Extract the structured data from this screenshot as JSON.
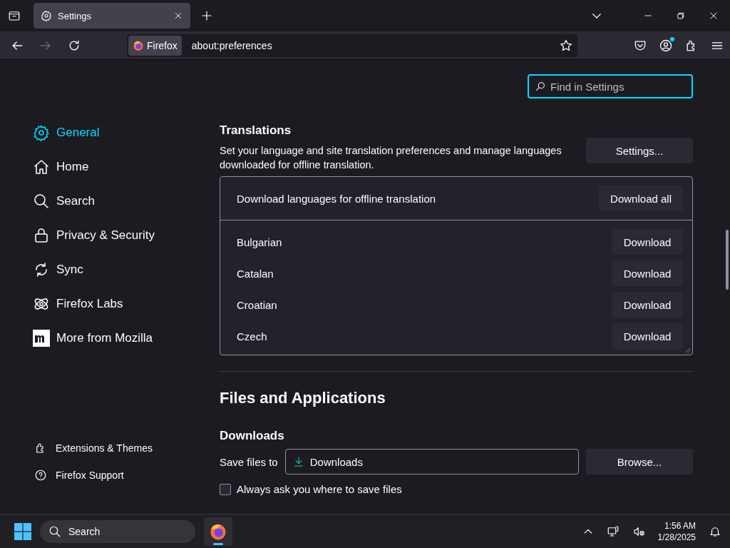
{
  "browser": {
    "tabs": [
      {
        "title": "Settings",
        "selected": true
      }
    ],
    "back": {
      "disabled": false
    },
    "forward": {
      "disabled": true
    },
    "identity": "Firefox",
    "url": "about:preferences"
  },
  "search": {
    "placeholder": "Find in Settings"
  },
  "sidebar": {
    "items": [
      {
        "label": "General",
        "selected": true
      },
      {
        "label": "Home",
        "selected": false
      },
      {
        "label": "Search",
        "selected": false
      },
      {
        "label": "Privacy & Security",
        "selected": false
      },
      {
        "label": "Sync",
        "selected": false
      },
      {
        "label": "Firefox Labs",
        "selected": false
      },
      {
        "label": "More from Mozilla",
        "selected": false
      }
    ],
    "footer": [
      "Extensions & Themes",
      "Firefox Support"
    ]
  },
  "translations": {
    "heading": "Translations",
    "description": "Set your language and site translation preferences and manage languages downloaded for offline translation.",
    "settings_button": "Settings...",
    "list_header": "Download languages for offline translation",
    "download_all_button": "Download all",
    "languages": [
      {
        "name": "Bulgarian",
        "button": "Download"
      },
      {
        "name": "Catalan",
        "button": "Download"
      },
      {
        "name": "Croatian",
        "button": "Download"
      },
      {
        "name": "Czech",
        "button": "Download"
      }
    ]
  },
  "files": {
    "heading": "Files and Applications",
    "downloads_heading": "Downloads",
    "save_label": "Save files to",
    "folder": "Downloads",
    "browse_button": "Browse...",
    "always_ask": {
      "label": "Always ask you where to save files",
      "checked": false
    }
  },
  "taskbar": {
    "search": "Search",
    "time": "1:56 AM",
    "date": "1/28/2025"
  }
}
